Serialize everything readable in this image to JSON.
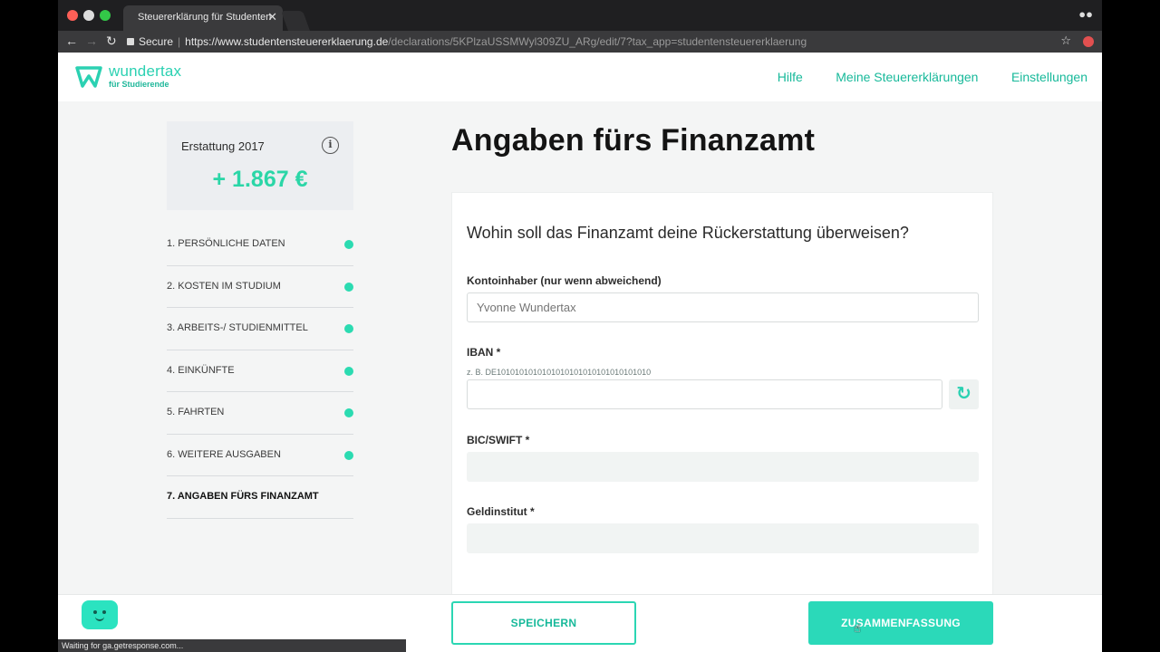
{
  "browser": {
    "tab_title": "Steuererklärung für Studenten",
    "tab_close": "✕",
    "secure_label": "Secure",
    "url_main": "https://www.studentensteuererklaerung.de",
    "url_path": "/declarations/5KPlzaUSSMWyl309ZU_ARg/edit/7?tax_app=studentensteuererklaerung",
    "status_text": "Waiting for ga.getresponse.com..."
  },
  "header": {
    "logo_name": "wundertax",
    "logo_sub": "für Studierende",
    "nav": [
      "Hilfe",
      "Meine Steuererklärungen",
      "Einstellungen"
    ]
  },
  "sidebar": {
    "refund_label": "Erstattung 2017",
    "refund_amount": "+ 1.867 €",
    "steps": [
      {
        "label": "1. PERSÖNLICHE DATEN"
      },
      {
        "label": "2. KOSTEN IM STUDIUM"
      },
      {
        "label": "3. ARBEITS-/ STUDIENMITTEL"
      },
      {
        "label": "4. EINKÜNFTE"
      },
      {
        "label": "5. FAHRTEN"
      },
      {
        "label": "6. WEITERE AUSGABEN"
      },
      {
        "label": "7. ANGABEN FÜRS FINANZAMT"
      }
    ]
  },
  "main": {
    "title": "Angaben fürs Finanzamt",
    "question": "Wohin soll das Finanzamt deine Rückerstattung überweisen?",
    "account_holder_label": "Kontoinhaber (nur wenn abweichend)",
    "account_holder_placeholder": "Yvonne Wundertax",
    "iban_label": "IBAN *",
    "iban_hint": "z. B. DE1010101010101010101010101010101010",
    "iban_value": "",
    "bic_label": "BIC/SWIFT *",
    "bank_label": "Geldinstitut *"
  },
  "footer": {
    "save_label": "SPEICHERN",
    "summary_label": "ZUSAMMENFASSUNG"
  }
}
